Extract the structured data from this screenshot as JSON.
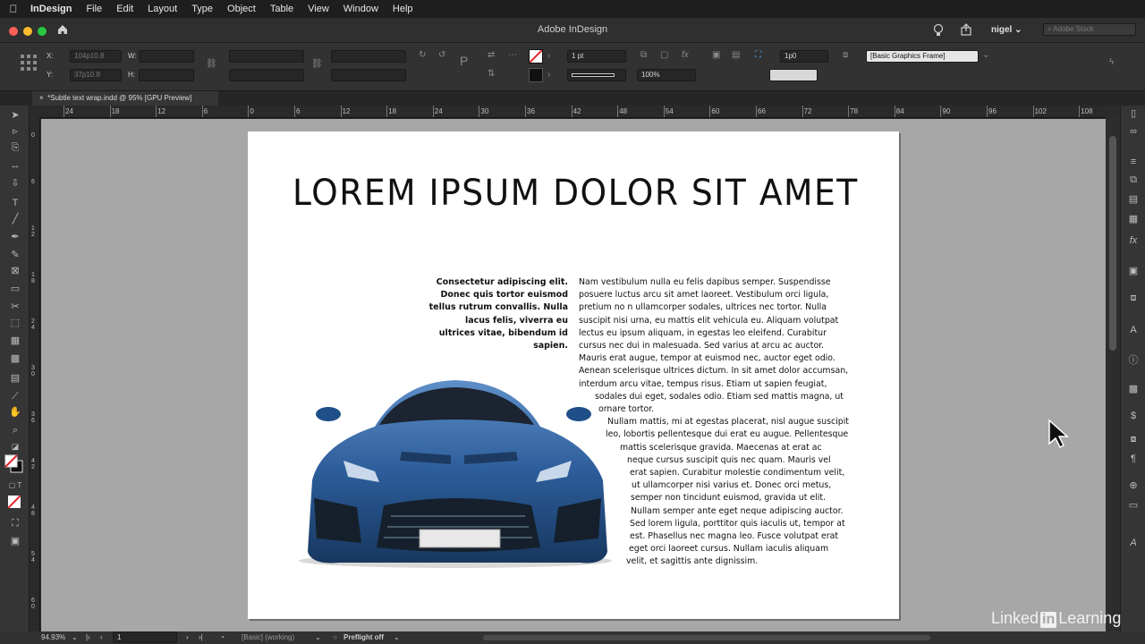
{
  "menubar": {
    "app": "InDesign",
    "items": [
      "File",
      "Edit",
      "Layout",
      "Type",
      "Object",
      "Table",
      "View",
      "Window",
      "Help"
    ]
  },
  "window": {
    "title": "Adobe InDesign",
    "user": "nigel",
    "search_placeholder": "Adobe Stock"
  },
  "control": {
    "x": "104p10.8",
    "y": "37p10.8",
    "w_label": "W:",
    "h_label": "H:",
    "x_label": "X:",
    "y_label": "Y:",
    "stroke": "1 pt",
    "opacity": "100%",
    "frame_offset": "1p0",
    "object_style": "[Basic Graphics Frame]"
  },
  "tab": {
    "label": "*Subtle text wrap.indd @ 95% [GPU Preview]",
    "close": "×"
  },
  "ruler": {
    "h": [
      "24",
      "18",
      "12",
      "6",
      "0",
      "6",
      "12",
      "18",
      "24",
      "30",
      "36",
      "42",
      "48",
      "54",
      "60",
      "66",
      "72",
      "78",
      "84",
      "90",
      "96",
      "102",
      "108"
    ],
    "v": [
      "0",
      "6",
      "1 2",
      "1 8",
      "2 4",
      "3 0",
      "3 6",
      "4 2",
      "4 8",
      "5 4",
      "6 0"
    ]
  },
  "document": {
    "headline": "LOREM IPSUM DOLOR SIT AMET",
    "caption": "Consectetur adipiscing elit. Donec quis tortor euismod tellus rutrum convallis. Nulla lacus felis, viverra eu ultrices vitae, bibendum id sapien.",
    "body_lines": [
      "Nam vestibulum nulla eu felis dapibus semper. Suspendisse",
      "posuere luctus arcu sit amet laoreet. Vestibulum orci ligula,",
      "pretium no n ullamcorper sodales, ultrices nec tortor. Nulla",
      "suscipit nisi urna, eu mattis elit vehicula eu. Aliquam volutpat",
      "lectus eu ipsum aliquam, in egestas leo eleifend. Curabitur",
      "cursus nec dui in malesuada. Sed varius at arcu ac auctor.",
      "Mauris erat augue, tempor at euismod nec, auctor eget odio.",
      "Aenean scelerisque ultrices dictum. In sit amet dolor accumsan,",
      "interdum arcu vitae, tempus risus. Etiam ut sapien feugiat,",
      "sodales dui eget, sodales odio. Etiam sed mattis magna, ut",
      "ornare tortor.",
      "Nullam mattis, mi at egestas placerat, nisl augue suscipit",
      "leo, lobortis pellentesque dui erat eu augue. Pellentesque",
      "mattis scelerisque gravida. Maecenas at erat ac",
      "neque cursus suscipit quis nec quam. Mauris vel",
      "erat sapien. Curabitur molestie condimentum velit,",
      "ut ullamcorper nisi varius et. Donec orci metus,",
      "semper non tincidunt euismod, gravida ut elit.",
      "Nullam semper ante eget neque adipiscing auctor.",
      "Sed lorem ligula, porttitor quis iaculis ut, tempor at",
      "est. Phasellus nec magna leo. Fusce volutpat erat",
      "eget orci laoreet cursus. Nullam iaculis aliquam",
      "velit, et sagittis ante dignissim."
    ]
  },
  "status": {
    "zoom": "94.93%",
    "page": "1",
    "style": "[Basic] (working)",
    "preflight": "Preflight off"
  },
  "watermark": {
    "pre": "Linked",
    "in": "in",
    "post": "Learning"
  },
  "icons": [
    "apple-icon",
    "home-icon",
    "lightbulb-icon",
    "share-icon",
    "search-icon",
    "selection-tool-icon",
    "type-tool-icon",
    "pen-tool-icon",
    "hand-tool-icon",
    "zoom-tool-icon",
    "pages-icon",
    "layers-icon",
    "links-icon",
    "stroke-icon",
    "color-icon",
    "swatches-icon",
    "fx-icon",
    "cursor-icon"
  ]
}
